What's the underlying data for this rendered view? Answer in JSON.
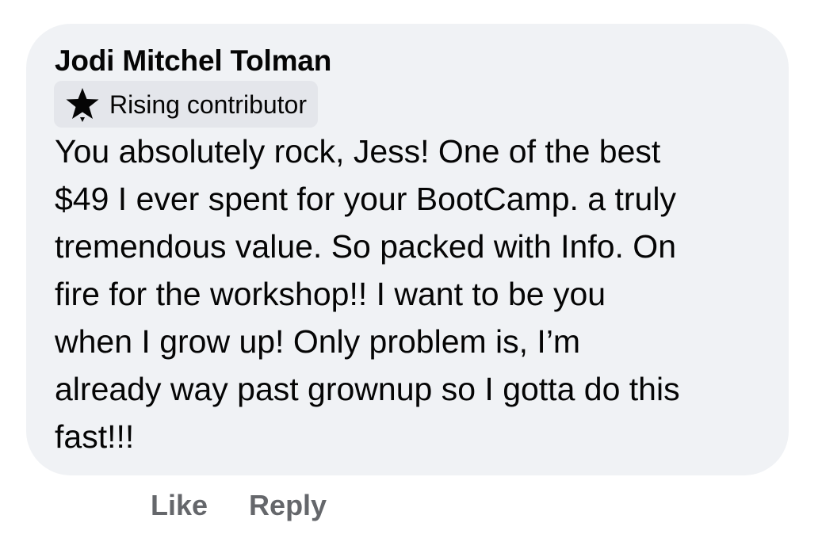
{
  "comment": {
    "author_name": "Jodi Mitchel Tolman",
    "badge": {
      "icon": "star-icon",
      "label": "Rising contributor"
    },
    "text_lines": [
      "You absolutely rock, Jess! One of the best",
      "$49 I ever spent for your BootCamp. a truly",
      "tremendous value. So packed with Info. On",
      "fire for the workshop!! I want to be you",
      "when I grow up! Only problem is, I’m",
      "already way past grownup so I gotta do this",
      "fast!!!"
    ]
  },
  "actions": {
    "like_label": "Like",
    "reply_label": "Reply"
  },
  "colors": {
    "bubble_background": "#f0f2f5",
    "badge_background": "#e4e6eb",
    "text_primary": "#050505",
    "text_secondary": "#65676b"
  }
}
